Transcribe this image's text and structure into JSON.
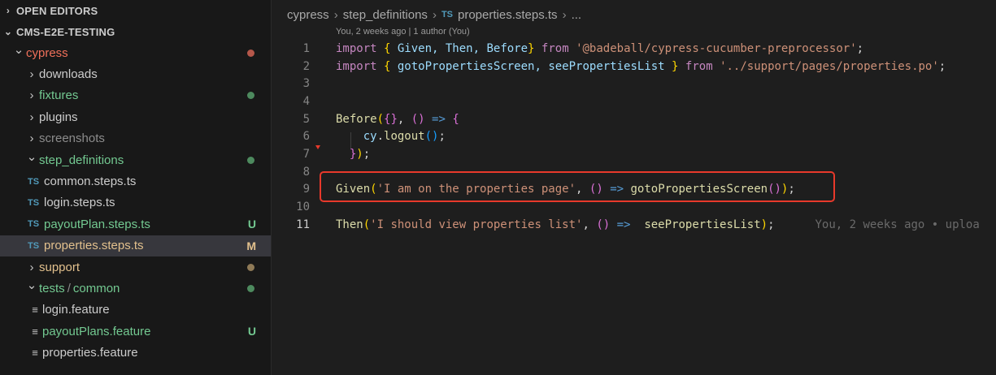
{
  "sidebar": {
    "open_editors": "OPEN EDITORS",
    "project": "CMS-E2E-TESTING",
    "items": [
      {
        "label": "cypress",
        "kind": "folder",
        "open": true,
        "color": "#f0705a",
        "status": "dot",
        "status_color": "#b5574a"
      },
      {
        "label": "downloads",
        "kind": "folder",
        "open": false,
        "color": "#cccccc"
      },
      {
        "label": "fixtures",
        "kind": "folder",
        "open": false,
        "color": "#73c991",
        "status": "dot",
        "status_color": "#4d8a5e"
      },
      {
        "label": "plugins",
        "kind": "folder",
        "open": false,
        "color": "#cccccc"
      },
      {
        "label": "screenshots",
        "kind": "folder",
        "open": false,
        "color": "#8c8c8c"
      },
      {
        "label": "step_definitions",
        "kind": "folder",
        "open": true,
        "color": "#73c991",
        "status": "dot",
        "status_color": "#4d8a5e"
      },
      {
        "label": "common.steps.ts",
        "kind": "ts",
        "color": "#cccccc"
      },
      {
        "label": "login.steps.ts",
        "kind": "ts",
        "color": "#cccccc"
      },
      {
        "label": "payoutPlan.steps.ts",
        "kind": "ts",
        "color": "#73c991",
        "status": "U",
        "status_color": "#73c991"
      },
      {
        "label": "properties.steps.ts",
        "kind": "ts",
        "color": "#e2c08d",
        "status": "M",
        "status_color": "#e2c08d",
        "selected": true
      },
      {
        "label": "support",
        "kind": "folder",
        "open": false,
        "color": "#e2c08d",
        "status": "dot",
        "status_color": "#8f7a57"
      },
      {
        "label": "tests",
        "label_sep": "/",
        "label_b": "common",
        "kind": "folder",
        "open": true,
        "color": "#73c991",
        "status": "dot",
        "status_color": "#4d8a5e"
      },
      {
        "label": "login.feature",
        "kind": "feature",
        "color": "#cccccc"
      },
      {
        "label": "payoutPlans.feature",
        "kind": "feature",
        "color": "#73c991",
        "status": "U",
        "status_color": "#73c991"
      },
      {
        "label": "properties.feature",
        "kind": "feature",
        "color": "#cccccc"
      }
    ]
  },
  "breadcrumb": {
    "part1": "cypress",
    "part2": "step_definitions",
    "ts_icon": "TS",
    "part3": "properties.steps.ts",
    "ellipsis": "..."
  },
  "blame_header": "You, 2 weeks ago | 1 author (You)",
  "code": {
    "line_numbers": [
      "1",
      "2",
      "3",
      "4",
      "5",
      "6",
      "7",
      "8",
      "9",
      "10",
      "11"
    ],
    "l1": {
      "kw1": "import",
      "b1": "{",
      "ids": " Given, Then, Before",
      "b2": "}",
      "kw2": "from",
      "str": "'@badeball/cypress-cucumber-preprocessor'",
      "end": ";"
    },
    "l2": {
      "kw1": "import",
      "b1": "{",
      "ids": " gotoPropertiesScreen, seePropertiesList ",
      "b2": "}",
      "kw2": "from",
      "str": "'../support/pages/properties.po'",
      "end": ";"
    },
    "l5": {
      "fn": "Before",
      "p1": "(",
      "b1": "{}",
      "comma": ", ",
      "p2": "()",
      "arrow": "=>",
      "b2": "{"
    },
    "l6": {
      "obj": "cy",
      "dot": ".",
      "fn": "logout",
      "p": "()",
      "end": ";"
    },
    "l7": {
      "b": "}",
      "p": ")",
      "end": ";"
    },
    "l9": {
      "fn": "Given",
      "p1": "(",
      "str": "'I am on the properties page'",
      "comma": ", ",
      "p2": "()",
      "arrow": "=>",
      "fn2": "gotoPropertiesScreen",
      "p3": "()",
      "p4": ")",
      "end": ";"
    },
    "l11": {
      "fn": "Then",
      "p1": "(",
      "str": "'I should view properties list'",
      "comma": ", ",
      "p2": "()",
      "arrow": "=>",
      "fn2": "seePropertiesList",
      "p4": ")",
      "end": ";",
      "blame": "You, 2 weeks ago • uploa"
    }
  },
  "colors": {
    "highlight_box": "#e8392b",
    "ts_icon": "#519aba"
  }
}
